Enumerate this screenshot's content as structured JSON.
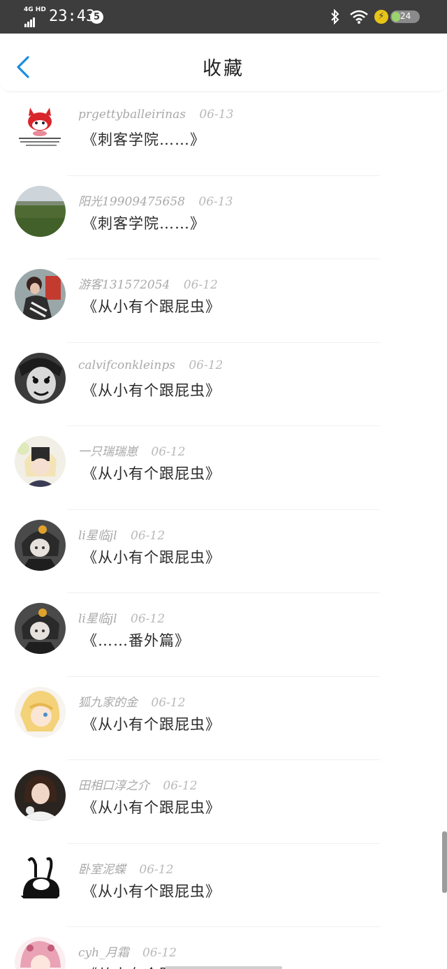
{
  "status_bar": {
    "network": "4G HD",
    "time": "23:43",
    "notification_count": "5",
    "battery": "24"
  },
  "header": {
    "title": "收藏"
  },
  "favorites": [
    {
      "user": "prgettyballeirinas",
      "date": "06-13",
      "book": "《刺客学院……》",
      "avatar_icon": "red-fox-cartoon-avatar"
    },
    {
      "user": "阳光19909475658",
      "date": "06-13",
      "book": "《刺客学院……》",
      "avatar_icon": "grassland-landscape-avatar"
    },
    {
      "user": "游客131572054",
      "date": "06-12",
      "book": "《从小有个跟屁虫》",
      "avatar_icon": "person-photo-avatar"
    },
    {
      "user": "calvifconkleinps",
      "date": "06-12",
      "book": "《从小有个跟屁虫》",
      "avatar_icon": "clown-face-avatar"
    },
    {
      "user": "一只瑞瑞崽",
      "date": "06-12",
      "book": "《从小有个跟屁虫》",
      "avatar_icon": "anime-girl-avatar"
    },
    {
      "user": "li星临jl",
      "date": "06-12",
      "book": "《从小有个跟屁虫》",
      "avatar_icon": "anime-character-avatar"
    },
    {
      "user": "li星临jl",
      "date": "06-12",
      "book": "《……番外篇》",
      "avatar_icon": "anime-character-avatar"
    },
    {
      "user": "狐九家的金",
      "date": "06-12",
      "book": "《从小有个跟屁虫》",
      "avatar_icon": "blonde-anime-avatar"
    },
    {
      "user": "田相口淳之介",
      "date": "06-12",
      "book": "《从小有个跟屁虫》",
      "avatar_icon": "girl-photo-avatar"
    },
    {
      "user": "卧室泥蝶",
      "date": "06-12",
      "book": "《从小有个跟屁虫》",
      "avatar_icon": "black-white-rabbit-avatar"
    },
    {
      "user": "cyh_月霜",
      "date": "06-12",
      "book": "《从小有个跟屁虫》",
      "avatar_icon": "pink-hair-anime-avatar"
    }
  ],
  "colors": {
    "accent": "#1a8ee1",
    "status_bar": "#3d3d3d",
    "username": "#a9a9a9",
    "book_title": "#2b2b2b"
  }
}
